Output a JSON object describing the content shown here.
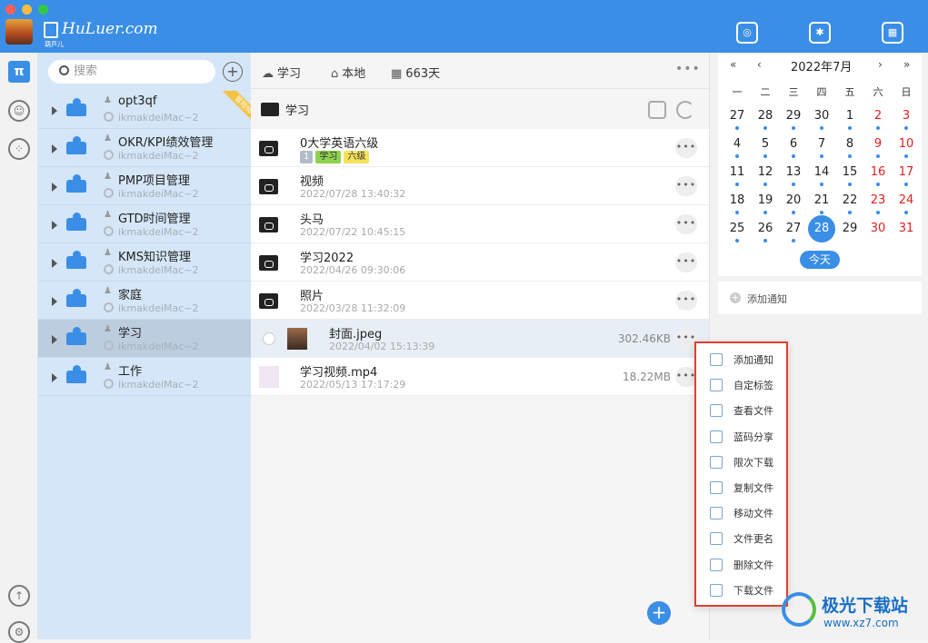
{
  "app": {
    "name": "HuLuer.com",
    "sub": "葫芦儿"
  },
  "tree": {
    "search_placeholder": "搜索",
    "items": [
      {
        "name": "opt3qf",
        "host": "ikmakdeiMac~2",
        "badge": "冒险师",
        "selected": false
      },
      {
        "name": "OKR/KPI绩效管理",
        "host": "ikmakdeiMac~2",
        "selected": false
      },
      {
        "name": "PMP项目管理",
        "host": "ikmakdeiMac~2",
        "selected": false
      },
      {
        "name": "GTD时间管理",
        "host": "ikmakdeiMac~2",
        "selected": false
      },
      {
        "name": "KMS知识管理",
        "host": "ikmakdeiMac~2",
        "selected": false
      },
      {
        "name": "家庭",
        "host": "ikmakdeiMac~2",
        "selected": false
      },
      {
        "name": "学习",
        "host": "ikmakdeiMac~2",
        "selected": true
      },
      {
        "name": "工作",
        "host": "ikmakdeiMac~2",
        "selected": false
      }
    ]
  },
  "main": {
    "header": {
      "folder": "学习",
      "location": "本地",
      "days": "663天"
    },
    "current_folder": "学习",
    "files": [
      {
        "name": "0大学英语六级",
        "date": "",
        "size": "",
        "tags": [
          "1",
          "学习",
          "六级"
        ],
        "type": "folder"
      },
      {
        "name": "视频",
        "date": "2022/07/28 13:40:32",
        "size": "",
        "type": "folder"
      },
      {
        "name": "头马",
        "date": "2022/07/22 10:45:15",
        "size": "",
        "type": "folder"
      },
      {
        "name": "学习2022",
        "date": "2022/04/26 09:30:06",
        "size": "",
        "type": "folder"
      },
      {
        "name": "照片",
        "date": "2022/03/28 11:32:09",
        "size": "",
        "type": "folder"
      },
      {
        "name": "封面.jpeg",
        "date": "2022/04/02 15:13:39",
        "size": "302.46KB",
        "type": "image"
      },
      {
        "name": "学习视频.mp4",
        "date": "2022/05/13 17:17:29",
        "size": "18.22MB",
        "type": "video"
      }
    ]
  },
  "calendar": {
    "title": "2022年7月",
    "nav": [
      "«",
      "‹",
      "›",
      "»"
    ],
    "weekdays": [
      "一",
      "二",
      "三",
      "四",
      "五",
      "六",
      "日"
    ],
    "weeks": [
      [
        27,
        28,
        29,
        30,
        1,
        2,
        3
      ],
      [
        4,
        5,
        6,
        7,
        8,
        9,
        10
      ],
      [
        11,
        12,
        13,
        14,
        15,
        16,
        17
      ],
      [
        18,
        19,
        20,
        21,
        22,
        23,
        24
      ],
      [
        25,
        26,
        27,
        28,
        29,
        30,
        31
      ]
    ],
    "today": 28,
    "today_label": "今天",
    "add_note": "添加通知"
  },
  "context_menu": [
    "添加通知",
    "自定标签",
    "查看文件",
    "蓝码分享",
    "限次下载",
    "复制文件",
    "移动文件",
    "文件更名",
    "删除文件",
    "下载文件"
  ],
  "watermark": {
    "title": "极光下载站",
    "url": "www.xz7.com"
  }
}
